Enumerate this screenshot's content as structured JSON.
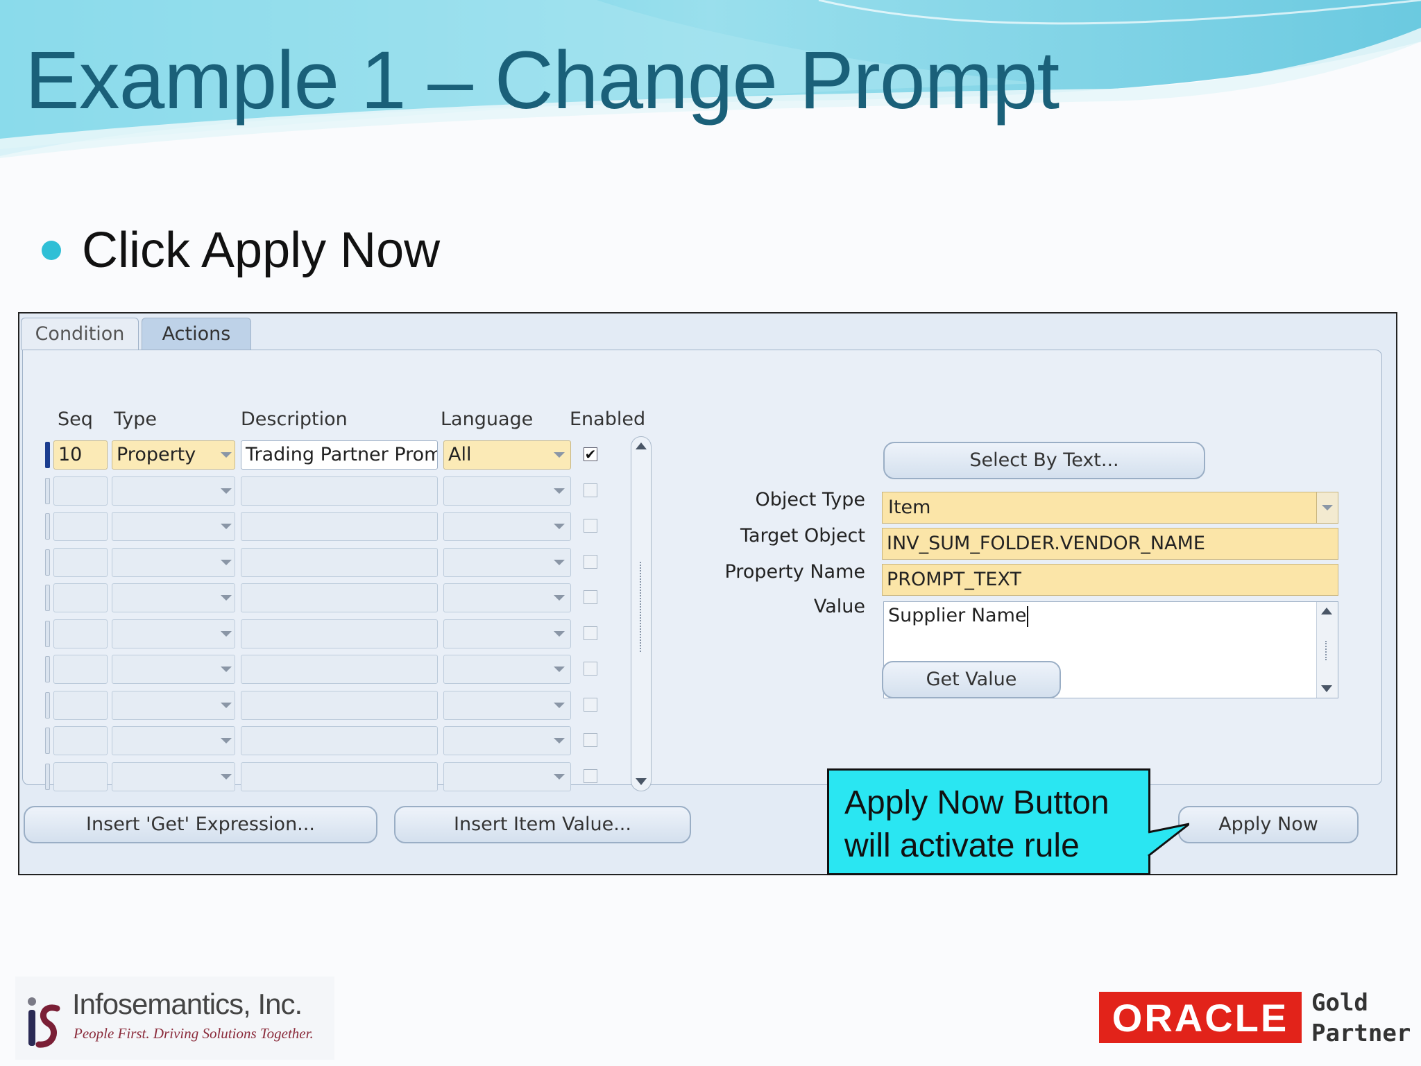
{
  "slide": {
    "title": "Example 1 – Change Prompt",
    "bullet": "Click Apply Now"
  },
  "tabs": [
    {
      "label": "Condition",
      "selected": false
    },
    {
      "label": "Actions",
      "selected": true
    }
  ],
  "grid": {
    "headers": {
      "seq": "Seq",
      "type": "Type",
      "description": "Description",
      "language": "Language",
      "enabled": "Enabled"
    },
    "rows": [
      {
        "seq": "10",
        "type": "Property",
        "description": "Trading Partner Prom",
        "language": "All",
        "enabled": true
      }
    ],
    "empty_row_count": 9
  },
  "actions": {
    "select_by_text_button": "Select By Text...",
    "object_type_label": "Object Type",
    "object_type_value": "Item",
    "target_object_label": "Target Object",
    "target_object_value": "INV_SUM_FOLDER.VENDOR_NAME",
    "property_name_label": "Property Name",
    "property_name_value": "PROMPT_TEXT",
    "value_label": "Value",
    "value_text": "Supplier Name",
    "get_value_button": "Get Value"
  },
  "footer_buttons": {
    "insert_get_expression": "Insert 'Get' Expression...",
    "insert_item_value": "Insert Item Value...",
    "apply_now": "Apply Now"
  },
  "callout": {
    "line1": "Apply Now Button",
    "line2": "will activate rule"
  },
  "logos": {
    "company_name": "Infosemantics, Inc.",
    "company_tagline": "People First. Driving Solutions Together.",
    "oracle_wordmark": "ORACLE",
    "partner_line1": "Gold",
    "partner_line2": "Partner"
  },
  "colors": {
    "title": "#1a6079",
    "required_field": "#fbe5a8",
    "callout_fill": "#2ae6f2",
    "oracle_red": "#e2231a"
  }
}
